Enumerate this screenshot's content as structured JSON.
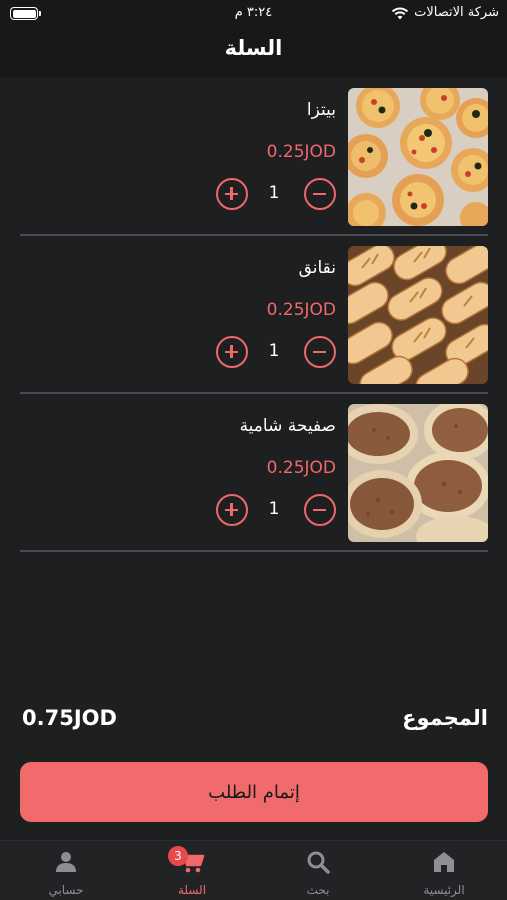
{
  "status_bar": {
    "carrier": "شركة الاتصالات",
    "time": "٣:٢٤ م"
  },
  "header": {
    "title": "السلة"
  },
  "cart_items": [
    {
      "name": "بيتزا",
      "price": "0.25JOD",
      "quantity": "1",
      "image": "pizza-image"
    },
    {
      "name": "نقانق",
      "price": "0.25JOD",
      "quantity": "1",
      "image": "sausage-rolls-image"
    },
    {
      "name": "صفيحة شامية",
      "price": "0.25JOD",
      "quantity": "1",
      "image": "sfiha-image"
    }
  ],
  "total": {
    "label": "المجموع",
    "value": "0.75JOD"
  },
  "checkout": {
    "label": "إتمام الطلب"
  },
  "tabbar": {
    "tabs": [
      {
        "label": "الرئيسية",
        "icon": "home-icon"
      },
      {
        "label": "بحث",
        "icon": "search-icon"
      },
      {
        "label": "السلة",
        "icon": "cart-icon",
        "badge": "3",
        "active": true
      },
      {
        "label": "حسابي",
        "icon": "user-icon"
      }
    ]
  },
  "colors": {
    "accent": "#f0686a",
    "background": "#1e1f21",
    "header": "#17181a"
  }
}
